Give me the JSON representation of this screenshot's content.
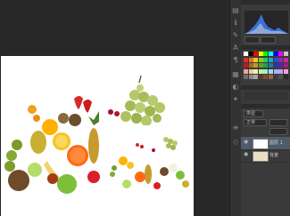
{
  "workspace": {
    "background": "#282828"
  },
  "panels": {
    "layers": {
      "kind_filter": "类型",
      "blend_mode": "正常",
      "rows": [
        {
          "name": "图层 1",
          "selected": true
        },
        {
          "name": "背景",
          "selected": false
        }
      ]
    },
    "swatch_colors": [
      "#ffffff",
      "#000000",
      "#ff0000",
      "#ffff00",
      "#00ff00",
      "#00ffff",
      "#0000ff",
      "#ff00ff",
      "#c8c8c8",
      "#e62828",
      "#e66e28",
      "#e6c828",
      "#8cc828",
      "#28c864",
      "#28a0c8",
      "#2850c8",
      "#8c28c8",
      "#c828a0",
      "#b41e1e",
      "#b4641e",
      "#b4a01e",
      "#64a01e",
      "#1ea050",
      "#1e7ca0",
      "#1e3ca0",
      "#641ea0",
      "#a01e7c",
      "#f0a0a0",
      "#f0c8a0",
      "#f0f0a0",
      "#c8f0a0",
      "#a0f0c8",
      "#a0dcf0",
      "#a0b4f0",
      "#c8a0f0",
      "#f0a0dc",
      "#6e6e6e",
      "#8c8c8c",
      "#a5a5a5",
      "#5a3c28",
      "#785032",
      "#96643c",
      "#3c3c3c",
      "#505050",
      "#282828"
    ]
  }
}
